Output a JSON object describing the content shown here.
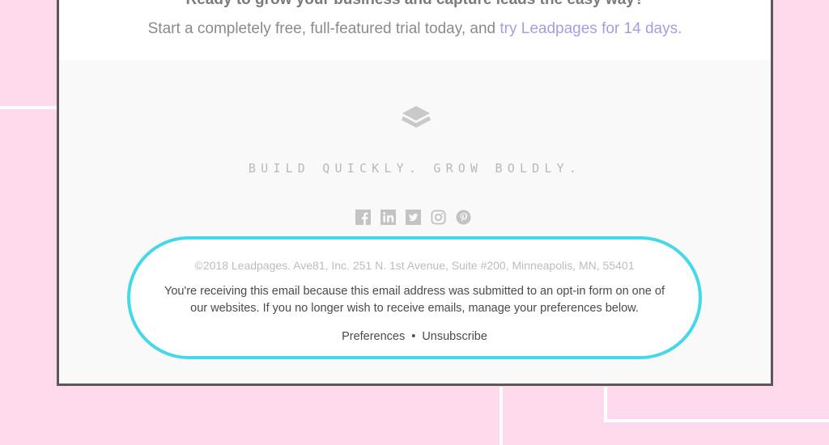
{
  "background": {
    "color": "#fddaeb",
    "line_color": "#ffffff"
  },
  "email": {
    "headline": "Ready to grow your business and capture leads the easy way?",
    "subline_text": "Start a completely free, full-featured trial today, and ",
    "subline_link": "try Leadpages for 14 days.",
    "link_color": "#a89be0"
  },
  "footer": {
    "logo_icon": "layers-icon",
    "tagline": "BUILD QUICKLY. GROW BOLDLY.",
    "socials": [
      {
        "name": "facebook",
        "icon": "facebook-icon"
      },
      {
        "name": "linkedin",
        "icon": "linkedin-icon"
      },
      {
        "name": "twitter",
        "icon": "twitter-icon"
      },
      {
        "name": "instagram",
        "icon": "instagram-icon"
      },
      {
        "name": "pinterest",
        "icon": "pinterest-icon"
      }
    ],
    "copyright": "©2018 Leadpages. Ave81, Inc. 251 N. 1st Avenue, Suite #200, Minneapolis, MN, 55401",
    "notice": "You're receiving this email because this email address was submitted to an opt-in form on one of our websites. If you no longer wish to receive emails, manage your preferences below.",
    "preferences_label": "Preferences",
    "separator": "•",
    "unsubscribe_label": "Unsubscribe",
    "highlight_color": "#45d7ea"
  }
}
